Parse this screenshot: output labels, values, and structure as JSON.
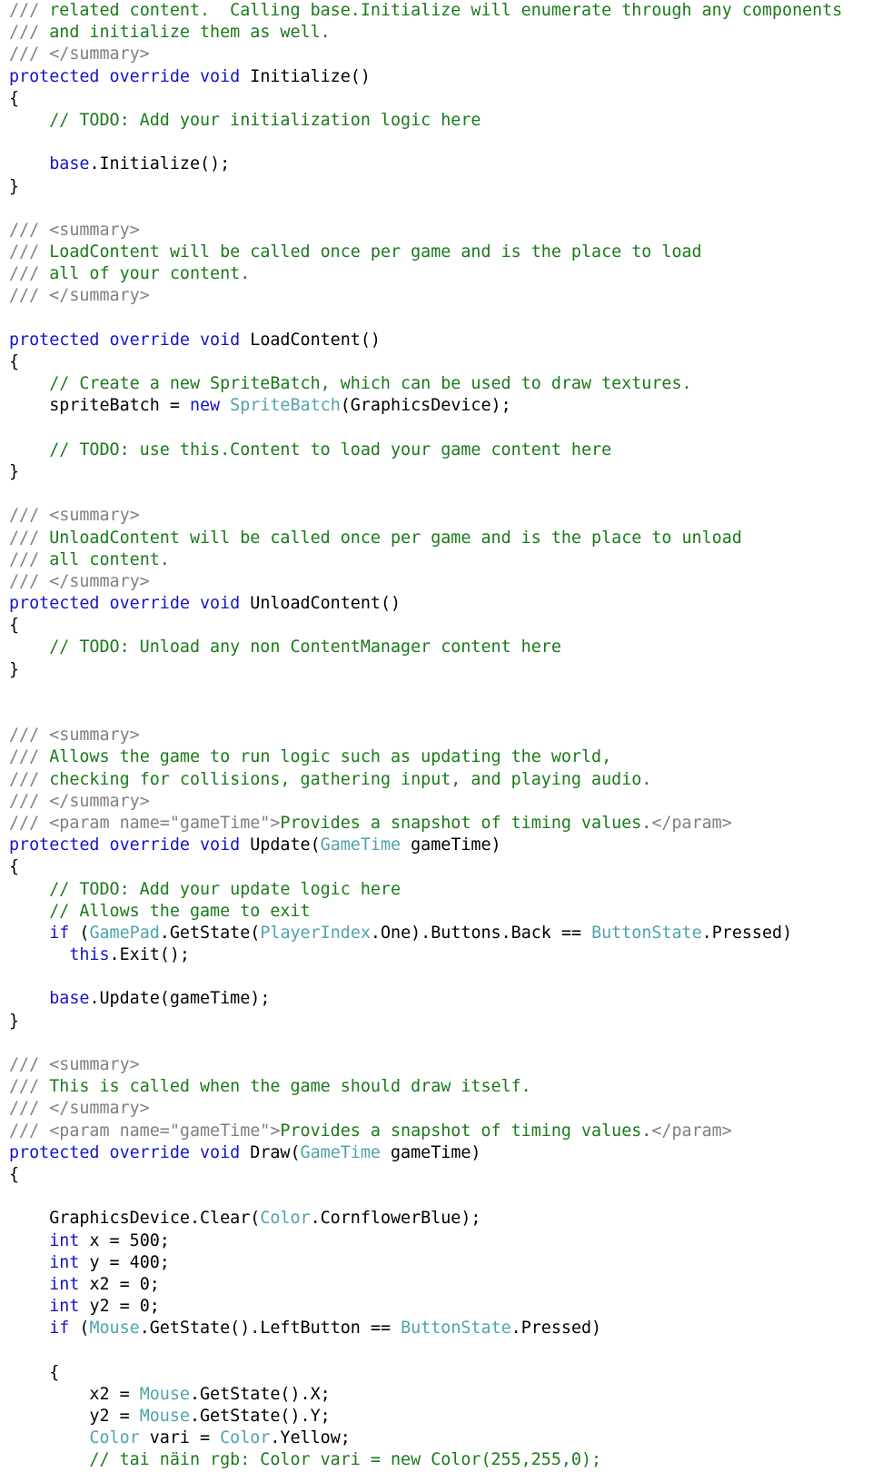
{
  "document": {
    "kind": "source-code-listing",
    "language": "C#",
    "colors": {
      "background": "#ffffff",
      "doc_tag": "#808080",
      "comment": "#1A7A1A",
      "keyword": "#1414C8",
      "type": "#4FA3AC",
      "plain": "#000000"
    }
  },
  "lines": [
    {
      "i": 0,
      "tokens": [
        {
          "t": "doc",
          "v": "/// "
        },
        {
          "t": "comment",
          "v": "related content.  Calling base.Initialize will enumerate through any components"
        }
      ]
    },
    {
      "i": 1,
      "tokens": [
        {
          "t": "doc",
          "v": "/// "
        },
        {
          "t": "comment",
          "v": "and initialize them as well."
        }
      ]
    },
    {
      "i": 2,
      "tokens": [
        {
          "t": "doc",
          "v": "/// </summary>"
        }
      ]
    },
    {
      "i": 3,
      "tokens": [
        {
          "t": "keyword",
          "v": "protected override void "
        },
        {
          "t": "plain",
          "v": "Initialize()"
        }
      ]
    },
    {
      "i": 4,
      "tokens": [
        {
          "t": "plain",
          "v": "{"
        }
      ]
    },
    {
      "i": 5,
      "tokens": [
        {
          "t": "comment",
          "v": "    // TODO: Add your initialization logic here"
        }
      ]
    },
    {
      "i": 6,
      "tokens": []
    },
    {
      "i": 7,
      "tokens": [
        {
          "t": "plain",
          "v": "    "
        },
        {
          "t": "keyword",
          "v": "base"
        },
        {
          "t": "plain",
          "v": ".Initialize();"
        }
      ]
    },
    {
      "i": 8,
      "tokens": [
        {
          "t": "plain",
          "v": "}"
        }
      ]
    },
    {
      "i": 9,
      "tokens": []
    },
    {
      "i": 10,
      "tokens": [
        {
          "t": "doc",
          "v": "/// <summary>"
        }
      ]
    },
    {
      "i": 11,
      "tokens": [
        {
          "t": "doc",
          "v": "/// "
        },
        {
          "t": "comment",
          "v": "LoadContent will be called once per game and is the place to load"
        }
      ]
    },
    {
      "i": 12,
      "tokens": [
        {
          "t": "doc",
          "v": "/// "
        },
        {
          "t": "comment",
          "v": "all of your content."
        }
      ]
    },
    {
      "i": 13,
      "tokens": [
        {
          "t": "doc",
          "v": "/// </summary>"
        }
      ]
    },
    {
      "i": 14,
      "tokens": []
    },
    {
      "i": 15,
      "tokens": [
        {
          "t": "keyword",
          "v": "protected override void "
        },
        {
          "t": "plain",
          "v": "LoadContent()"
        }
      ]
    },
    {
      "i": 16,
      "tokens": [
        {
          "t": "plain",
          "v": "{"
        }
      ]
    },
    {
      "i": 17,
      "tokens": [
        {
          "t": "comment",
          "v": "    // Create a new SpriteBatch, which can be used to draw textures."
        }
      ]
    },
    {
      "i": 18,
      "tokens": [
        {
          "t": "plain",
          "v": "    spriteBatch = "
        },
        {
          "t": "keyword",
          "v": "new "
        },
        {
          "t": "type",
          "v": "SpriteBatch"
        },
        {
          "t": "plain",
          "v": "(GraphicsDevice);"
        }
      ]
    },
    {
      "i": 19,
      "tokens": []
    },
    {
      "i": 20,
      "tokens": [
        {
          "t": "comment",
          "v": "    // TODO: use this.Content to load your game content here"
        }
      ]
    },
    {
      "i": 21,
      "tokens": [
        {
          "t": "plain",
          "v": "}"
        }
      ]
    },
    {
      "i": 22,
      "tokens": []
    },
    {
      "i": 23,
      "tokens": [
        {
          "t": "doc",
          "v": "/// <summary>"
        }
      ]
    },
    {
      "i": 24,
      "tokens": [
        {
          "t": "doc",
          "v": "/// "
        },
        {
          "t": "comment",
          "v": "UnloadContent will be called once per game and is the place to unload"
        }
      ]
    },
    {
      "i": 25,
      "tokens": [
        {
          "t": "doc",
          "v": "/// "
        },
        {
          "t": "comment",
          "v": "all content."
        }
      ]
    },
    {
      "i": 26,
      "tokens": [
        {
          "t": "doc",
          "v": "/// </summary>"
        }
      ]
    },
    {
      "i": 27,
      "tokens": [
        {
          "t": "keyword",
          "v": "protected override void "
        },
        {
          "t": "plain",
          "v": "UnloadContent()"
        }
      ]
    },
    {
      "i": 28,
      "tokens": [
        {
          "t": "plain",
          "v": "{"
        }
      ]
    },
    {
      "i": 29,
      "tokens": [
        {
          "t": "comment",
          "v": "    // TODO: Unload any non ContentManager content here"
        }
      ]
    },
    {
      "i": 30,
      "tokens": [
        {
          "t": "plain",
          "v": "}"
        }
      ]
    },
    {
      "i": 31,
      "tokens": []
    },
    {
      "i": 32,
      "tokens": []
    },
    {
      "i": 33,
      "tokens": [
        {
          "t": "doc",
          "v": "/// <summary>"
        }
      ]
    },
    {
      "i": 34,
      "tokens": [
        {
          "t": "doc",
          "v": "/// "
        },
        {
          "t": "comment",
          "v": "Allows the game to run logic such as updating the world,"
        }
      ]
    },
    {
      "i": 35,
      "tokens": [
        {
          "t": "doc",
          "v": "/// "
        },
        {
          "t": "comment",
          "v": "checking for collisions, gathering input, and playing audio."
        }
      ]
    },
    {
      "i": 36,
      "tokens": [
        {
          "t": "doc",
          "v": "/// </summary>"
        }
      ]
    },
    {
      "i": 37,
      "tokens": [
        {
          "t": "doc",
          "v": "/// <param name=\"gameTime\">"
        },
        {
          "t": "comment",
          "v": "Provides a snapshot of timing values."
        },
        {
          "t": "doc",
          "v": "</param>"
        }
      ]
    },
    {
      "i": 38,
      "tokens": [
        {
          "t": "keyword",
          "v": "protected override void "
        },
        {
          "t": "plain",
          "v": "Update("
        },
        {
          "t": "type",
          "v": "GameTime"
        },
        {
          "t": "plain",
          "v": " gameTime)"
        }
      ]
    },
    {
      "i": 39,
      "tokens": [
        {
          "t": "plain",
          "v": "{"
        }
      ]
    },
    {
      "i": 40,
      "tokens": [
        {
          "t": "comment",
          "v": "    // TODO: Add your update logic here"
        }
      ]
    },
    {
      "i": 41,
      "tokens": [
        {
          "t": "comment",
          "v": "    // Allows the game to exit"
        }
      ]
    },
    {
      "i": 42,
      "tokens": [
        {
          "t": "plain",
          "v": "    "
        },
        {
          "t": "keyword",
          "v": "if"
        },
        {
          "t": "plain",
          "v": " ("
        },
        {
          "t": "type",
          "v": "GamePad"
        },
        {
          "t": "plain",
          "v": ".GetState("
        },
        {
          "t": "type",
          "v": "PlayerIndex"
        },
        {
          "t": "plain",
          "v": ".One).Buttons.Back == "
        },
        {
          "t": "type",
          "v": "ButtonState"
        },
        {
          "t": "plain",
          "v": ".Pressed)"
        }
      ]
    },
    {
      "i": 43,
      "tokens": [
        {
          "t": "plain",
          "v": "      "
        },
        {
          "t": "keyword",
          "v": "this"
        },
        {
          "t": "plain",
          "v": ".Exit();"
        }
      ]
    },
    {
      "i": 44,
      "tokens": []
    },
    {
      "i": 45,
      "tokens": [
        {
          "t": "plain",
          "v": "    "
        },
        {
          "t": "keyword",
          "v": "base"
        },
        {
          "t": "plain",
          "v": ".Update(gameTime);"
        }
      ]
    },
    {
      "i": 46,
      "tokens": [
        {
          "t": "plain",
          "v": "}"
        }
      ]
    },
    {
      "i": 47,
      "tokens": []
    },
    {
      "i": 48,
      "tokens": [
        {
          "t": "doc",
          "v": "/// <summary>"
        }
      ]
    },
    {
      "i": 49,
      "tokens": [
        {
          "t": "doc",
          "v": "/// "
        },
        {
          "t": "comment",
          "v": "This is called when the game should draw itself."
        }
      ]
    },
    {
      "i": 50,
      "tokens": [
        {
          "t": "doc",
          "v": "/// </summary>"
        }
      ]
    },
    {
      "i": 51,
      "tokens": [
        {
          "t": "doc",
          "v": "/// <param name=\"gameTime\">"
        },
        {
          "t": "comment",
          "v": "Provides a snapshot of timing values."
        },
        {
          "t": "doc",
          "v": "</param>"
        }
      ]
    },
    {
      "i": 52,
      "tokens": [
        {
          "t": "keyword",
          "v": "protected override void "
        },
        {
          "t": "plain",
          "v": "Draw("
        },
        {
          "t": "type",
          "v": "GameTime"
        },
        {
          "t": "plain",
          "v": " gameTime)"
        }
      ]
    },
    {
      "i": 53,
      "tokens": [
        {
          "t": "plain",
          "v": "{"
        }
      ]
    },
    {
      "i": 54,
      "tokens": []
    },
    {
      "i": 55,
      "tokens": [
        {
          "t": "plain",
          "v": "    GraphicsDevice.Clear("
        },
        {
          "t": "type",
          "v": "Color"
        },
        {
          "t": "plain",
          "v": ".CornflowerBlue);"
        }
      ]
    },
    {
      "i": 56,
      "tokens": [
        {
          "t": "plain",
          "v": "    "
        },
        {
          "t": "keyword",
          "v": "int"
        },
        {
          "t": "plain",
          "v": " x = 500;"
        }
      ]
    },
    {
      "i": 57,
      "tokens": [
        {
          "t": "plain",
          "v": "    "
        },
        {
          "t": "keyword",
          "v": "int"
        },
        {
          "t": "plain",
          "v": " y = 400;"
        }
      ]
    },
    {
      "i": 58,
      "tokens": [
        {
          "t": "plain",
          "v": "    "
        },
        {
          "t": "keyword",
          "v": "int"
        },
        {
          "t": "plain",
          "v": " x2 = 0;"
        }
      ]
    },
    {
      "i": 59,
      "tokens": [
        {
          "t": "plain",
          "v": "    "
        },
        {
          "t": "keyword",
          "v": "int"
        },
        {
          "t": "plain",
          "v": " y2 = 0;"
        }
      ]
    },
    {
      "i": 60,
      "tokens": [
        {
          "t": "plain",
          "v": "    "
        },
        {
          "t": "keyword",
          "v": "if"
        },
        {
          "t": "plain",
          "v": " ("
        },
        {
          "t": "type",
          "v": "Mouse"
        },
        {
          "t": "plain",
          "v": ".GetState().LeftButton == "
        },
        {
          "t": "type",
          "v": "ButtonState"
        },
        {
          "t": "plain",
          "v": ".Pressed)"
        }
      ]
    },
    {
      "i": 61,
      "tokens": []
    },
    {
      "i": 62,
      "tokens": [
        {
          "t": "plain",
          "v": "    {"
        }
      ]
    },
    {
      "i": 63,
      "tokens": [
        {
          "t": "plain",
          "v": "        x2 = "
        },
        {
          "t": "type",
          "v": "Mouse"
        },
        {
          "t": "plain",
          "v": ".GetState().X;"
        }
      ]
    },
    {
      "i": 64,
      "tokens": [
        {
          "t": "plain",
          "v": "        y2 = "
        },
        {
          "t": "type",
          "v": "Mouse"
        },
        {
          "t": "plain",
          "v": ".GetState().Y;"
        }
      ]
    },
    {
      "i": 65,
      "tokens": [
        {
          "t": "plain",
          "v": "        "
        },
        {
          "t": "type",
          "v": "Color"
        },
        {
          "t": "plain",
          "v": " vari = "
        },
        {
          "t": "type",
          "v": "Color"
        },
        {
          "t": "plain",
          "v": ".Yellow;"
        }
      ]
    },
    {
      "i": 66,
      "tokens": [
        {
          "t": "comment",
          "v": "        // tai näin rgb: Color vari = new Color(255,255,0);"
        }
      ]
    }
  ]
}
